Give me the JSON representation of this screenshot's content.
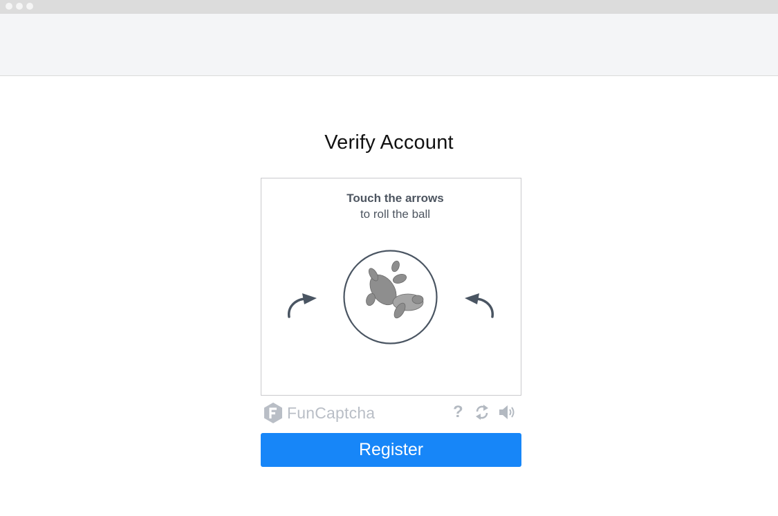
{
  "page": {
    "title": "Verify Account"
  },
  "captcha": {
    "instruction_title": "Touch the arrows",
    "instruction_subtitle": "to roll the ball",
    "brand": "FunCaptcha",
    "help_symbol": "?",
    "left_arrow_icon": "rotate-left-icon",
    "right_arrow_icon": "rotate-right-icon",
    "refresh_icon": "refresh-icon",
    "audio_icon": "speaker-icon",
    "image_subject": "animal-figure"
  },
  "actions": {
    "register_label": "Register"
  },
  "colors": {
    "accent": "#1786f8",
    "text_muted": "#4d5560",
    "brand_gray": "#b9bec6",
    "ball_outline": "#4a5562"
  }
}
